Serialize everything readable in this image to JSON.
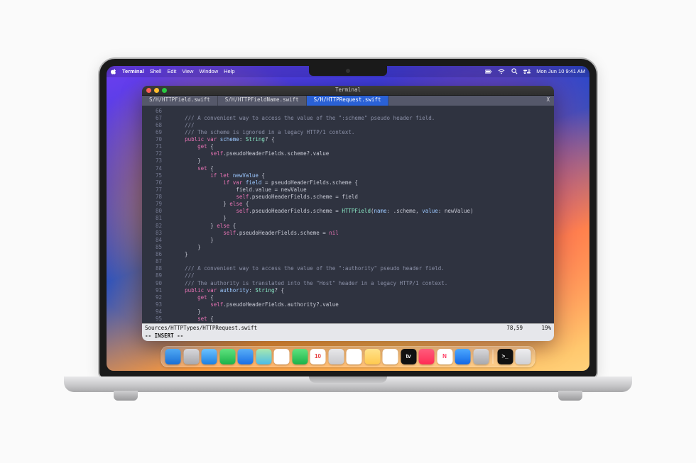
{
  "menubar": {
    "app": "Terminal",
    "items": [
      "Shell",
      "Edit",
      "View",
      "Window",
      "Help"
    ],
    "clock": "Mon Jun 10  9:41 AM"
  },
  "terminal": {
    "title": "Terminal",
    "tabs": [
      {
        "label": "S/H/HTTPField.swift",
        "active": false
      },
      {
        "label": "S/H/HTTPFieldName.swift",
        "active": false
      },
      {
        "label": "S/H/HTTPRequest.swift",
        "active": true
      }
    ],
    "close_x": "X",
    "status_path": "Sources/HTTPTypes/HTTPRequest.swift",
    "status_pos": "78,59",
    "status_pct": "19%",
    "insert": "-- INSERT --",
    "code": [
      {
        "n": 66,
        "tokens": []
      },
      {
        "n": 67,
        "tokens": [
          [
            "c-pn",
            "    "
          ],
          [
            "c-com",
            "/// A convenient way to access the value of the \":scheme\" pseudo header field."
          ]
        ]
      },
      {
        "n": 68,
        "tokens": [
          [
            "c-pn",
            "    "
          ],
          [
            "c-com",
            "///"
          ]
        ]
      },
      {
        "n": 69,
        "tokens": [
          [
            "c-pn",
            "    "
          ],
          [
            "c-com",
            "/// The scheme is ignored in a legacy HTTP/1 context."
          ]
        ]
      },
      {
        "n": 70,
        "tokens": [
          [
            "c-pn",
            "    "
          ],
          [
            "c-kw",
            "public var "
          ],
          [
            "c-id",
            "scheme"
          ],
          [
            "c-pn",
            ": "
          ],
          [
            "c-fn",
            "String"
          ],
          [
            "c-pn",
            "? {"
          ]
        ]
      },
      {
        "n": 71,
        "tokens": [
          [
            "c-pn",
            "        "
          ],
          [
            "c-kw",
            "get"
          ],
          [
            "c-pn",
            " {"
          ]
        ]
      },
      {
        "n": 72,
        "tokens": [
          [
            "c-pn",
            "            "
          ],
          [
            "c-kw",
            "self"
          ],
          [
            "c-pn",
            ".pseudoHeaderFields.scheme?.value"
          ]
        ]
      },
      {
        "n": 73,
        "tokens": [
          [
            "c-pn",
            "        }"
          ]
        ]
      },
      {
        "n": 74,
        "tokens": [
          [
            "c-pn",
            "        "
          ],
          [
            "c-kw",
            "set"
          ],
          [
            "c-pn",
            " {"
          ]
        ]
      },
      {
        "n": 75,
        "tokens": [
          [
            "c-pn",
            "            "
          ],
          [
            "c-kw",
            "if let "
          ],
          [
            "c-id",
            "newValue"
          ],
          [
            "c-pn",
            " {"
          ]
        ]
      },
      {
        "n": 76,
        "tokens": [
          [
            "c-pn",
            "                "
          ],
          [
            "c-kw",
            "if var "
          ],
          [
            "c-id",
            "field"
          ],
          [
            "c-pn",
            " = pseudoHeaderFields.scheme {"
          ]
        ]
      },
      {
        "n": 77,
        "tokens": [
          [
            "c-pn",
            "                    field.value = newValue"
          ]
        ]
      },
      {
        "n": 78,
        "tokens": [
          [
            "c-pn",
            "                    "
          ],
          [
            "c-kw",
            "self"
          ],
          [
            "c-pn",
            ".pseudoHeaderFields.scheme = field"
          ]
        ]
      },
      {
        "n": 79,
        "tokens": [
          [
            "c-pn",
            "                } "
          ],
          [
            "c-kw",
            "else"
          ],
          [
            "c-pn",
            " {"
          ]
        ]
      },
      {
        "n": 80,
        "tokens": [
          [
            "c-pn",
            "                    "
          ],
          [
            "c-kw",
            "self"
          ],
          [
            "c-pn",
            ".pseudoHeaderFields.scheme = "
          ],
          [
            "c-fn",
            "HTTPField"
          ],
          [
            "c-pn",
            "("
          ],
          [
            "c-id",
            "name"
          ],
          [
            "c-pn",
            ": .scheme, "
          ],
          [
            "c-id",
            "value"
          ],
          [
            "c-pn",
            ": newValue)"
          ]
        ]
      },
      {
        "n": 81,
        "tokens": [
          [
            "c-pn",
            "                }"
          ]
        ]
      },
      {
        "n": 82,
        "tokens": [
          [
            "c-pn",
            "            } "
          ],
          [
            "c-kw",
            "else"
          ],
          [
            "c-pn",
            " {"
          ]
        ]
      },
      {
        "n": 83,
        "tokens": [
          [
            "c-pn",
            "                "
          ],
          [
            "c-kw",
            "self"
          ],
          [
            "c-pn",
            ".pseudoHeaderFields.scheme = "
          ],
          [
            "c-kw",
            "nil"
          ]
        ]
      },
      {
        "n": 84,
        "tokens": [
          [
            "c-pn",
            "            }"
          ]
        ]
      },
      {
        "n": 85,
        "tokens": [
          [
            "c-pn",
            "        }"
          ]
        ]
      },
      {
        "n": 86,
        "tokens": [
          [
            "c-pn",
            "    }"
          ]
        ]
      },
      {
        "n": 87,
        "tokens": []
      },
      {
        "n": 88,
        "tokens": [
          [
            "c-pn",
            "    "
          ],
          [
            "c-com",
            "/// A convenient way to access the value of the \":authority\" pseudo header field."
          ]
        ]
      },
      {
        "n": 89,
        "tokens": [
          [
            "c-pn",
            "    "
          ],
          [
            "c-com",
            "///"
          ]
        ]
      },
      {
        "n": 90,
        "tokens": [
          [
            "c-pn",
            "    "
          ],
          [
            "c-com",
            "/// The authority is translated into the \"Host\" header in a legacy HTTP/1 context."
          ]
        ]
      },
      {
        "n": 91,
        "tokens": [
          [
            "c-pn",
            "    "
          ],
          [
            "c-kw",
            "public var "
          ],
          [
            "c-id",
            "authority"
          ],
          [
            "c-pn",
            ": "
          ],
          [
            "c-fn",
            "String"
          ],
          [
            "c-pn",
            "? {"
          ]
        ]
      },
      {
        "n": 92,
        "tokens": [
          [
            "c-pn",
            "        "
          ],
          [
            "c-kw",
            "get"
          ],
          [
            "c-pn",
            " {"
          ]
        ]
      },
      {
        "n": 93,
        "tokens": [
          [
            "c-pn",
            "            "
          ],
          [
            "c-kw",
            "self"
          ],
          [
            "c-pn",
            ".pseudoHeaderFields.authority?.value"
          ]
        ]
      },
      {
        "n": 94,
        "tokens": [
          [
            "c-pn",
            "        }"
          ]
        ]
      },
      {
        "n": 95,
        "tokens": [
          [
            "c-pn",
            "        "
          ],
          [
            "c-kw",
            "set"
          ],
          [
            "c-pn",
            " {"
          ]
        ]
      }
    ]
  },
  "dock": {
    "items": [
      {
        "name": "finder",
        "bg": "linear-gradient(#4fa9f4,#1a6fd6)",
        "glyph": ""
      },
      {
        "name": "launchpad",
        "bg": "linear-gradient(#d8d8dc,#a8a8ac)",
        "glyph": ""
      },
      {
        "name": "safari",
        "bg": "linear-gradient(#6bc2ff,#1d7fe0)",
        "glyph": ""
      },
      {
        "name": "messages",
        "bg": "linear-gradient(#5fe27e,#1bb24a)",
        "glyph": ""
      },
      {
        "name": "mail",
        "bg": "linear-gradient(#58aef7,#1a6fe6)",
        "glyph": ""
      },
      {
        "name": "maps",
        "bg": "linear-gradient(#a7e8b0,#4dbce6)",
        "glyph": ""
      },
      {
        "name": "photos",
        "bg": "#ffffff",
        "glyph": ""
      },
      {
        "name": "facetime",
        "bg": "linear-gradient(#5fe27e,#1bb24a)",
        "glyph": ""
      },
      {
        "name": "calendar",
        "bg": "#ffffff",
        "glyph": "10",
        "text": "#e63b3b"
      },
      {
        "name": "contacts",
        "bg": "linear-gradient(#e8e8ea,#c8c8cc)",
        "glyph": ""
      },
      {
        "name": "reminders",
        "bg": "#ffffff",
        "glyph": ""
      },
      {
        "name": "notes",
        "bg": "linear-gradient(#ffe28a,#ffc94f)",
        "glyph": ""
      },
      {
        "name": "freeform",
        "bg": "#ffffff",
        "glyph": ""
      },
      {
        "name": "tv",
        "bg": "#111",
        "glyph": "tv",
        "text": "#fff"
      },
      {
        "name": "music",
        "bg": "linear-gradient(#ff5c7c,#ff2d55)",
        "glyph": ""
      },
      {
        "name": "news",
        "bg": "#ffffff",
        "glyph": "N",
        "text": "#ff375f"
      },
      {
        "name": "appstore",
        "bg": "linear-gradient(#4ca8ff,#1368e6)",
        "glyph": ""
      },
      {
        "name": "settings",
        "bg": "linear-gradient(#d8d8dc,#a8a8ac)",
        "glyph": ""
      }
    ],
    "items2": [
      {
        "name": "terminal-app",
        "bg": "#111",
        "glyph": ">_",
        "text": "#fff"
      },
      {
        "name": "trash",
        "bg": "linear-gradient(#ededf0,#cfd0d4)",
        "glyph": ""
      }
    ]
  }
}
